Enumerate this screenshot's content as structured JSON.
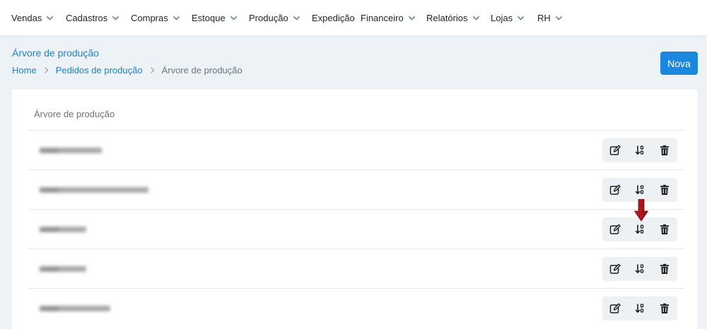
{
  "nav": {
    "items": [
      {
        "label": "Vendas",
        "dropdown": true
      },
      {
        "label": "Cadastros",
        "dropdown": true
      },
      {
        "label": "Compras",
        "dropdown": true
      },
      {
        "label": "Estoque",
        "dropdown": true
      },
      {
        "label": "Produção",
        "dropdown": true
      },
      {
        "label": "Expedição",
        "dropdown": false
      },
      {
        "label": "Financeiro",
        "dropdown": true
      },
      {
        "label": "Relatórios",
        "dropdown": true
      },
      {
        "label": "Lojas",
        "dropdown": true
      },
      {
        "label": "RH",
        "dropdown": true
      }
    ]
  },
  "page": {
    "title": "Árvore de produção",
    "new_button": "Nova"
  },
  "breadcrumb": {
    "home": "Home",
    "parent": "Pedidos de produção",
    "current": "Árvore de produção"
  },
  "table": {
    "header": "Árvore de produção",
    "rows": [
      {
        "name": "redacted"
      },
      {
        "name": "redacted"
      },
      {
        "name": "redacted"
      },
      {
        "name": "redacted"
      },
      {
        "name": "redacted"
      }
    ],
    "row_actions": [
      "edit-icon",
      "sort-icon",
      "trash-icon"
    ]
  },
  "colors": {
    "accent": "#1d83c9",
    "primary_button": "#1b87de",
    "annotation_arrow": "#b8141b",
    "background": "#edf2f7"
  }
}
